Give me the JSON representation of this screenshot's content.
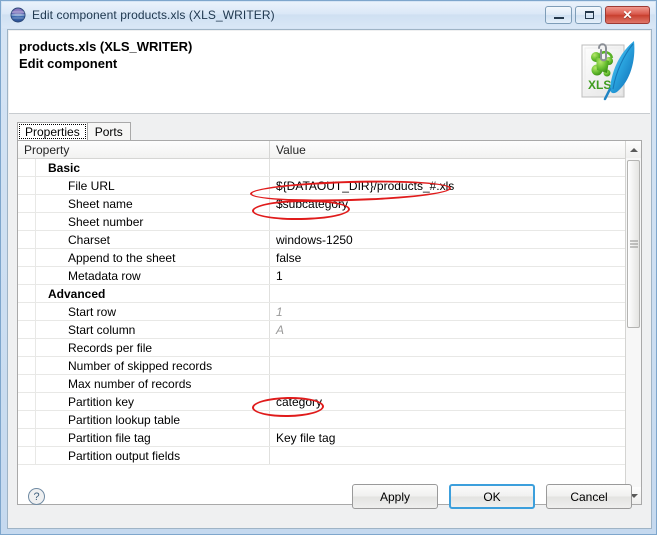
{
  "window": {
    "title": "Edit component products.xls (XLS_WRITER)",
    "app_icon": "clover-sphere-icon",
    "controls": {
      "minimize": "minimize-icon",
      "maximize": "maximize-icon",
      "close": "✕"
    }
  },
  "header": {
    "title": "products.xls (XLS_WRITER)",
    "subtitle": "Edit component",
    "icon": "xls-writer-document-icon",
    "icon_label": "XLS"
  },
  "tabs": [
    {
      "label": "Properties",
      "active": true
    },
    {
      "label": "Ports",
      "active": false
    }
  ],
  "table": {
    "columns": [
      "Property",
      "Value"
    ],
    "rows": [
      {
        "kind": "group",
        "property": "Basic",
        "value": ""
      },
      {
        "kind": "item",
        "property": "File URL",
        "value": "${DATAOUT_DIR}/products_#.xls"
      },
      {
        "kind": "item",
        "property": "Sheet name",
        "value": "$subcategory"
      },
      {
        "kind": "item",
        "property": "Sheet number",
        "value": ""
      },
      {
        "kind": "item",
        "property": "Charset",
        "value": "windows-1250"
      },
      {
        "kind": "item",
        "property": "Append to the sheet",
        "value": "false"
      },
      {
        "kind": "item",
        "property": "Metadata row",
        "value": "1"
      },
      {
        "kind": "group",
        "property": "Advanced",
        "value": ""
      },
      {
        "kind": "item",
        "property": "Start row",
        "value": "1",
        "muted": true
      },
      {
        "kind": "item",
        "property": "Start column",
        "value": "A",
        "muted": true
      },
      {
        "kind": "item",
        "property": "Records per file",
        "value": ""
      },
      {
        "kind": "item",
        "property": "Number of skipped records",
        "value": ""
      },
      {
        "kind": "item",
        "property": "Max number of records",
        "value": ""
      },
      {
        "kind": "item",
        "property": "Partition key",
        "value": "category"
      },
      {
        "kind": "item",
        "property": "Partition lookup table",
        "value": ""
      },
      {
        "kind": "item",
        "property": "Partition file tag",
        "value": "Key file tag"
      },
      {
        "kind": "item",
        "property": "Partition output fields",
        "value": ""
      }
    ]
  },
  "footer": {
    "help": "?",
    "apply": "Apply",
    "ok": "OK",
    "cancel": "Cancel"
  },
  "annotations": {
    "color": "#e01b1b",
    "highlighted": [
      "File URL value",
      "Sheet name value",
      "Partition key value"
    ]
  }
}
